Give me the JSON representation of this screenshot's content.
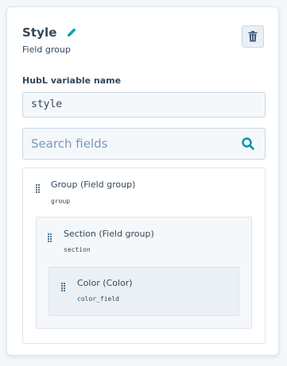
{
  "panel": {
    "title": "Style",
    "subtitle": "Field group",
    "edit_icon": "pencil-icon",
    "delete_icon": "trash-icon"
  },
  "variable": {
    "label": "HubL variable name",
    "value": "style"
  },
  "search": {
    "placeholder": "Search fields",
    "icon": "search-icon"
  },
  "tree": {
    "group": {
      "label": "Group (Field group)",
      "var": "group",
      "section": {
        "label": "Section (Field group)",
        "var": "section",
        "color": {
          "label": "Color (Color)",
          "var": "color_field"
        }
      }
    }
  },
  "colors": {
    "accent": "#00a4bd",
    "text": "#33475b",
    "border": "#cbd6e2"
  }
}
